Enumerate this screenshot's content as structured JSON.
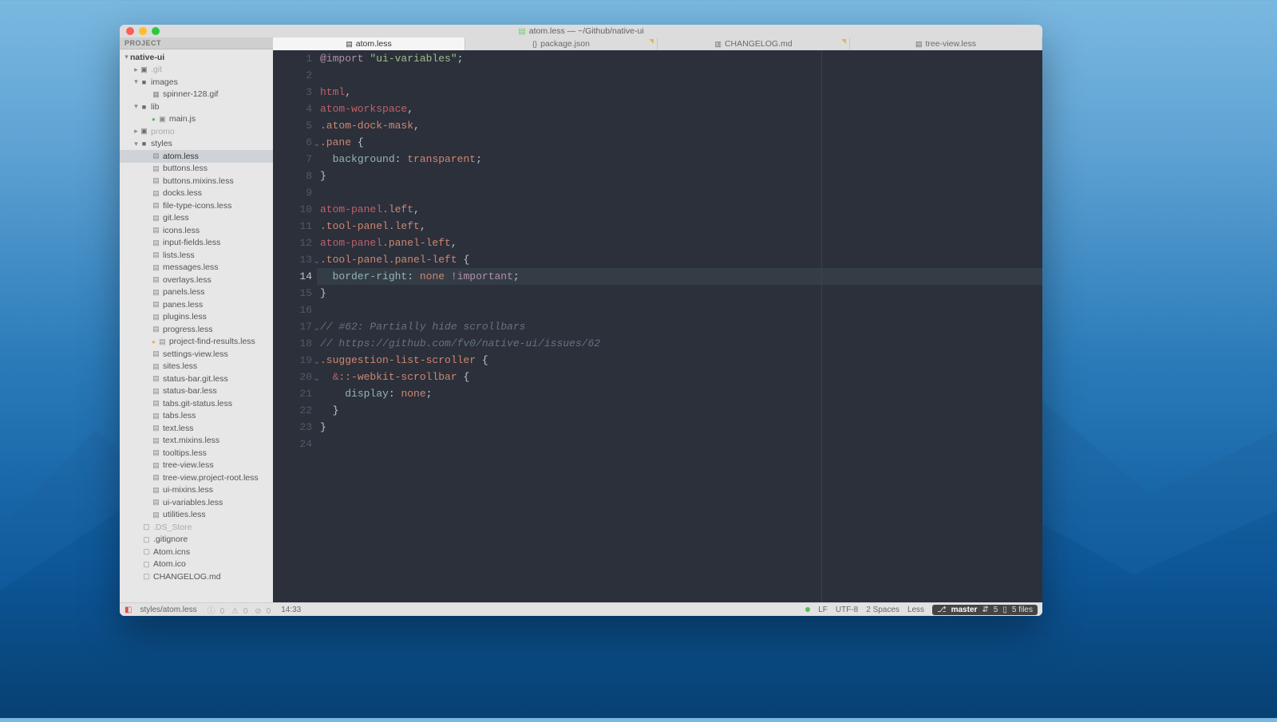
{
  "window": {
    "title": "atom.less — ~/Github/native-ui"
  },
  "sidebar": {
    "header": "PROJECT",
    "root": "native-ui",
    "folders": {
      "git": ".git",
      "images": "images",
      "images_child": "spinner-128.gif",
      "lib": "lib",
      "lib_child": "main.js",
      "promo": "promo",
      "styles": "styles"
    },
    "style_files": [
      "atom.less",
      "buttons.less",
      "buttons.mixins.less",
      "docks.less",
      "file-type-icons.less",
      "git.less",
      "icons.less",
      "input-fields.less",
      "lists.less",
      "messages.less",
      "overlays.less",
      "panels.less",
      "panes.less",
      "plugins.less",
      "progress.less",
      "project-find-results.less",
      "settings-view.less",
      "sites.less",
      "status-bar.git.less",
      "status-bar.less",
      "tabs.git-status.less",
      "tabs.less",
      "text.less",
      "text.mixins.less",
      "tooltips.less",
      "tree-view.less",
      "tree-view.project-root.less",
      "ui-mixins.less",
      "ui-variables.less",
      "utilities.less"
    ],
    "root_files": [
      ".DS_Store",
      ".gitignore",
      "Atom.icns",
      "Atom.ico",
      "CHANGELOG.md"
    ]
  },
  "tabs": [
    {
      "label": "atom.less",
      "active": true,
      "modified": false,
      "icon": "code"
    },
    {
      "label": "package.json",
      "active": false,
      "modified": true,
      "icon": "braces"
    },
    {
      "label": "CHANGELOG.md",
      "active": false,
      "modified": true,
      "icon": "md"
    },
    {
      "label": "tree-view.less",
      "active": false,
      "modified": false,
      "icon": "code"
    }
  ],
  "editor": {
    "current_line": 14,
    "lines": 24
  },
  "status": {
    "file": "styles/atom.less",
    "diagnostics": {
      "info": 0,
      "warn": 0,
      "error": 0
    },
    "cursor": "14:33",
    "line_ending": "LF",
    "encoding": "UTF-8",
    "indent": "2 Spaces",
    "grammar": "Less",
    "git_branch": "master",
    "git_ahead": "5",
    "git_files": "5 files"
  }
}
